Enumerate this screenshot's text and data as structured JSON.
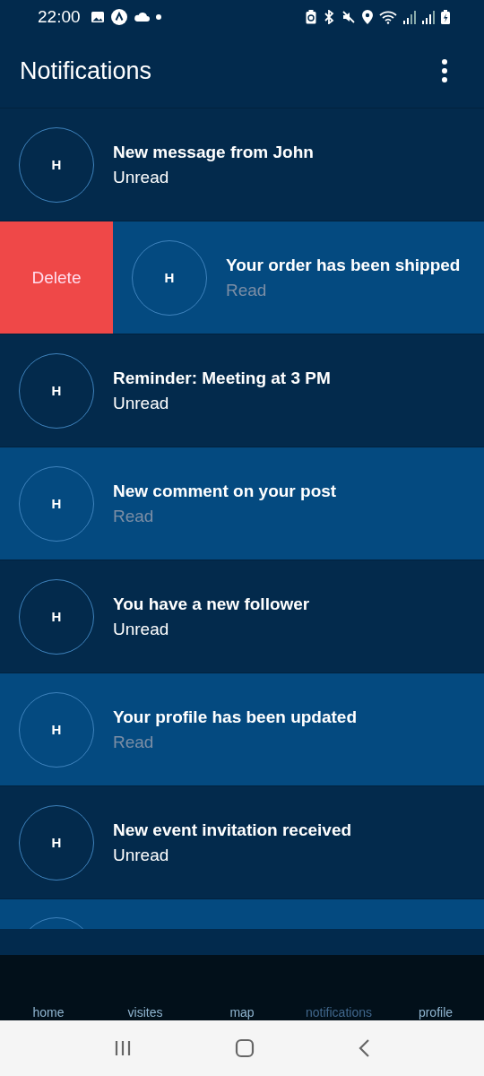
{
  "status_bar": {
    "time": "22:00"
  },
  "app_bar": {
    "title": "Notifications"
  },
  "notifications": [
    {
      "avatar": "H",
      "title": "New message from John",
      "status": "Unread",
      "read": false,
      "swiped": false
    },
    {
      "avatar": "H",
      "title": "Your order has been shipped",
      "status": "Read",
      "read": true,
      "swiped": true,
      "action": "Delete"
    },
    {
      "avatar": "H",
      "title": "Reminder: Meeting at 3 PM",
      "status": "Unread",
      "read": false,
      "swiped": false
    },
    {
      "avatar": "H",
      "title": "New comment on your post",
      "status": "Read",
      "read": true,
      "swiped": false
    },
    {
      "avatar": "H",
      "title": "You have a new follower",
      "status": "Unread",
      "read": false,
      "swiped": false
    },
    {
      "avatar": "H",
      "title": "Your profile has been updated",
      "status": "Read",
      "read": true,
      "swiped": false
    },
    {
      "avatar": "H",
      "title": "New event invitation received",
      "status": "Unread",
      "read": false,
      "swiped": false
    }
  ],
  "cut_off_row": {
    "read": true
  },
  "bottom_nav": [
    {
      "label": "home",
      "selected": false
    },
    {
      "label": "visites",
      "selected": false
    },
    {
      "label": "map",
      "selected": false
    },
    {
      "label": "notifications",
      "selected": true
    },
    {
      "label": "profile",
      "selected": false
    }
  ]
}
